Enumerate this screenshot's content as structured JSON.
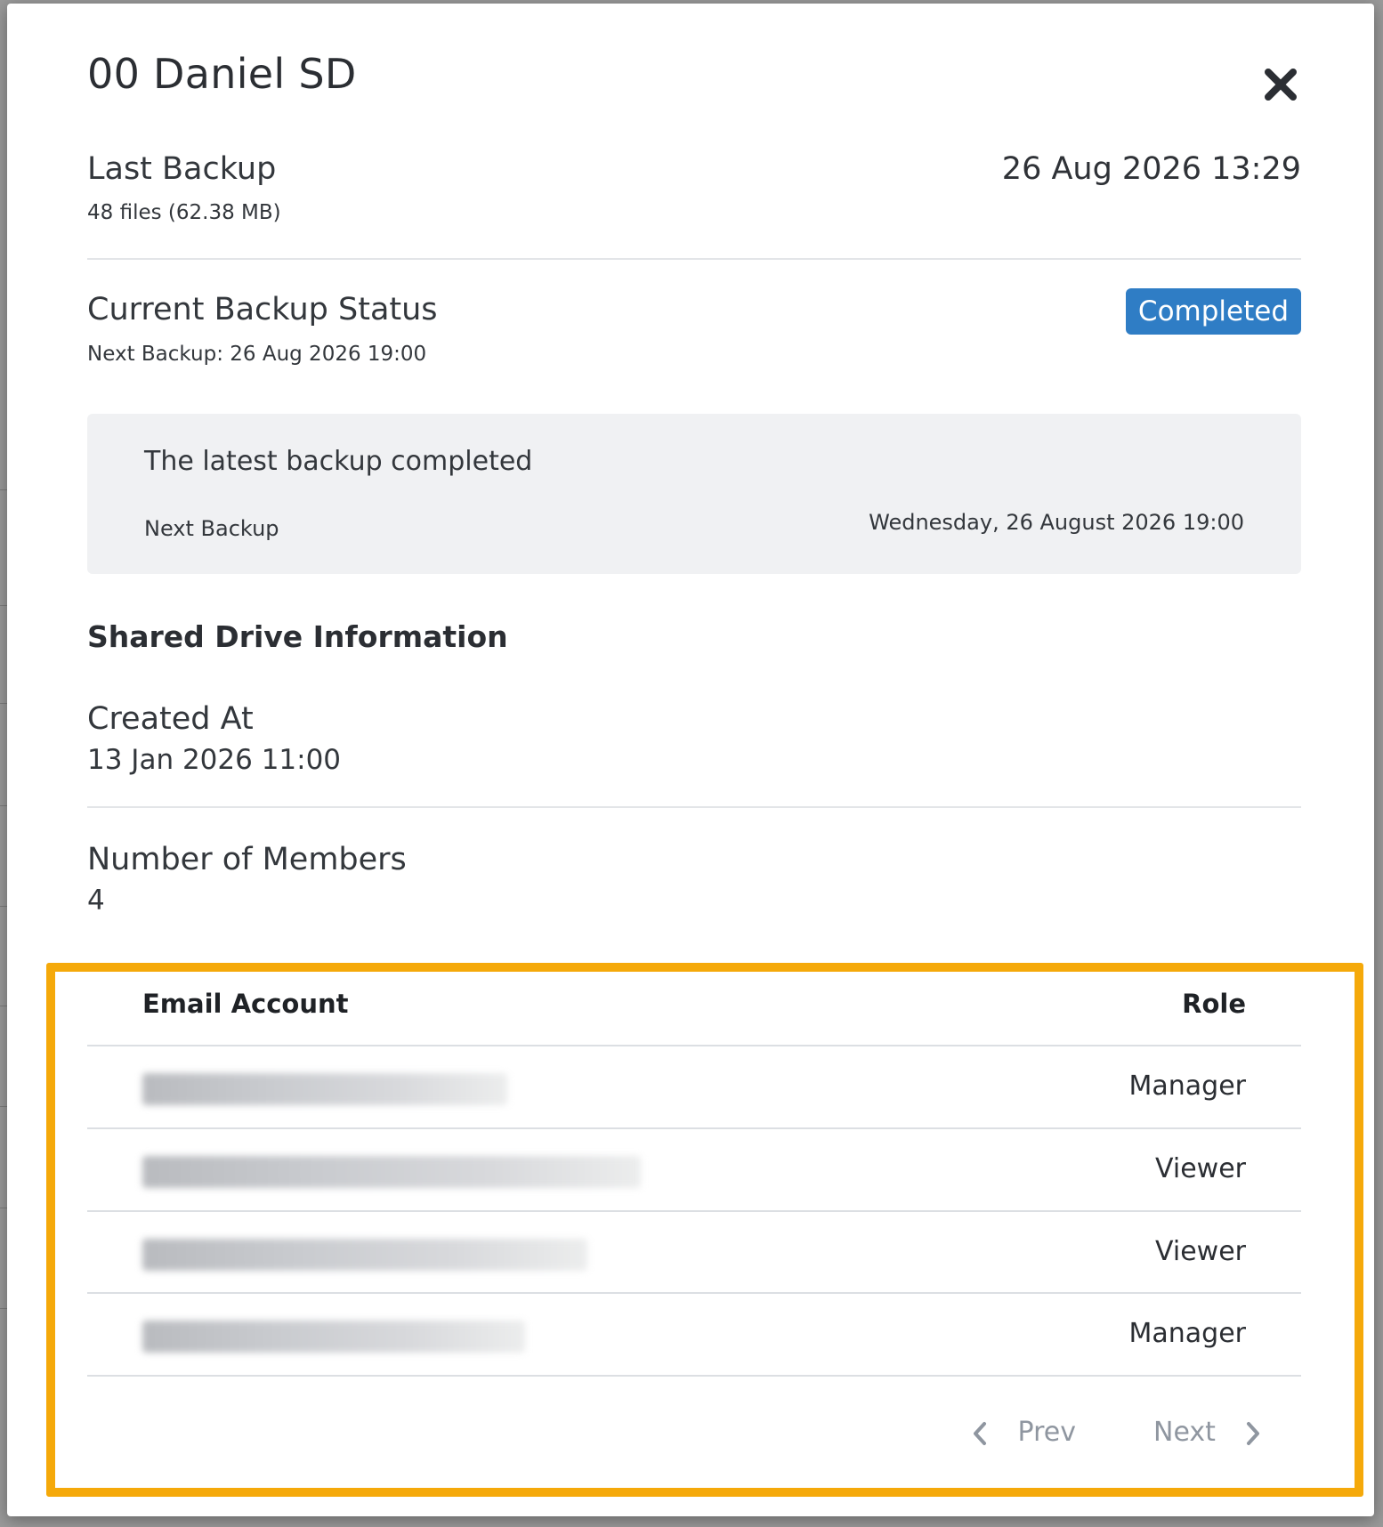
{
  "modal": {
    "title": "00 Daniel SD",
    "last_backup": {
      "label": "Last Backup",
      "summary": "48 files (62.38 MB)",
      "datetime": "26 Aug 2026 13:29"
    },
    "current_status": {
      "label": "Current Backup Status",
      "next_backup": "Next Backup: 26 Aug 2026 19:00",
      "badge": "Completed"
    },
    "status_box": {
      "message": "The latest backup completed",
      "next_label": "Next Backup",
      "next_value": "Wednesday, 26 August 2026 19:00"
    },
    "shared_drive": {
      "heading": "Shared Drive Information",
      "created_label": "Created At",
      "created_value": "13 Jan 2026 11:00",
      "members_label": "Number of Members",
      "members_value": "4"
    },
    "members_table": {
      "headers": {
        "email": "Email Account",
        "role": "Role"
      },
      "rows": [
        {
          "role": "Manager"
        },
        {
          "role": "Viewer"
        },
        {
          "role": "Viewer"
        },
        {
          "role": "Manager"
        }
      ]
    },
    "pagination": {
      "prev": "Prev",
      "next": "Next"
    }
  },
  "colors": {
    "badge": "#2f7dc5",
    "highlight": "#f5a90a",
    "box_bg": "#f0f1f3"
  },
  "icons": {
    "close": "close-icon",
    "prev": "chevron-left-icon",
    "next": "chevron-right-icon"
  }
}
